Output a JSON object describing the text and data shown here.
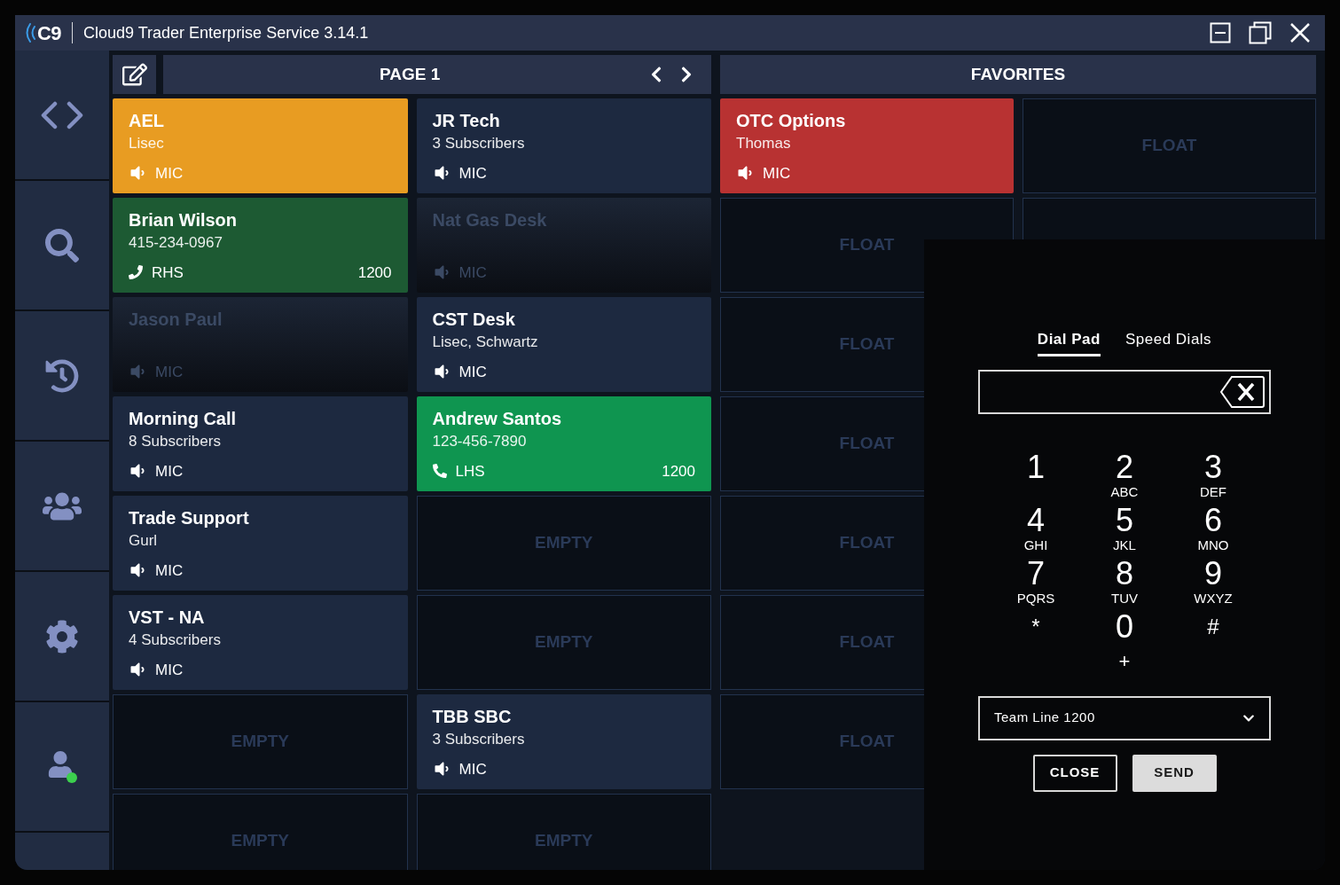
{
  "window": {
    "logo": "C9",
    "title": "Cloud9 Trader Enterprise Service 3.14.1"
  },
  "sidebar": {
    "items": [
      {
        "kind": "code"
      },
      {
        "kind": "search"
      },
      {
        "kind": "history"
      },
      {
        "kind": "users"
      },
      {
        "kind": "settings"
      },
      {
        "kind": "presence",
        "color": "#3ccf4e"
      }
    ]
  },
  "page": {
    "title": "PAGE 1",
    "tiles": [
      {
        "kind": "colored",
        "color": "#e89c22",
        "title": "AEL",
        "subtitle": "Lisec",
        "line": {
          "kind": "speaker",
          "label": "MIC"
        }
      },
      {
        "kind": "normal",
        "title": "JR Tech",
        "subtitle": "3 Subscribers",
        "line": {
          "kind": "speaker",
          "label": "MIC"
        }
      },
      {
        "kind": "colored",
        "color": "#1d5a33",
        "title": "Brian Wilson",
        "subtitle": "415-234-0967",
        "line": {
          "kind": "handset",
          "label": "RHS"
        },
        "extension": "1200"
      },
      {
        "kind": "inactive",
        "title": "Nat Gas Desk",
        "line": {
          "kind": "speaker",
          "label": "MIC"
        }
      },
      {
        "kind": "inactive",
        "title": "Jason Paul",
        "line": {
          "kind": "speaker",
          "label": "MIC"
        }
      },
      {
        "kind": "normal",
        "title": "CST Desk",
        "subtitle": "Lisec, Schwartz",
        "line": {
          "kind": "speaker",
          "label": "MIC"
        }
      },
      {
        "kind": "normal",
        "title": "Morning Call",
        "subtitle": "8 Subscribers",
        "line": {
          "kind": "speaker",
          "label": "MIC"
        }
      },
      {
        "kind": "colored",
        "color": "#0f9550",
        "title": "Andrew Santos",
        "subtitle": "123-456-7890",
        "line": {
          "kind": "phone",
          "label": "LHS"
        },
        "extension": "1200"
      },
      {
        "kind": "normal",
        "title": "Trade Support",
        "subtitle": "Gurl",
        "line": {
          "kind": "speaker",
          "label": "MIC"
        }
      },
      {
        "kind": "empty",
        "label": "EMPTY"
      },
      {
        "kind": "normal",
        "title": "VST - NA",
        "subtitle": "4 Subscribers",
        "line": {
          "kind": "speaker",
          "label": "MIC"
        }
      },
      {
        "kind": "empty",
        "label": "EMPTY"
      },
      {
        "kind": "empty",
        "label": "EMPTY"
      },
      {
        "kind": "normal",
        "title": "TBB SBC",
        "subtitle": "3 Subscribers",
        "line": {
          "kind": "speaker",
          "label": "MIC"
        }
      },
      {
        "kind": "empty",
        "label": "EMPTY"
      },
      {
        "kind": "empty",
        "label": "EMPTY"
      }
    ]
  },
  "favorites": {
    "title": "FAVORITES",
    "tiles": [
      {
        "kind": "colored",
        "color": "#b83232",
        "title": "OTC Options",
        "subtitle": "Thomas",
        "line": {
          "kind": "speaker",
          "label": "MIC"
        }
      },
      {
        "kind": "empty",
        "label": "FLOAT"
      },
      {
        "kind": "empty",
        "label": "FLOAT"
      },
      {
        "kind": "empty"
      },
      {
        "kind": "empty",
        "label": "FLOAT"
      },
      {
        "kind": "blank"
      },
      {
        "kind": "empty",
        "label": "FLOAT"
      },
      {
        "kind": "blank"
      },
      {
        "kind": "empty",
        "label": "FLOAT"
      },
      {
        "kind": "blank"
      },
      {
        "kind": "empty",
        "label": "FLOAT"
      },
      {
        "kind": "blank"
      },
      {
        "kind": "empty",
        "label": "FLOAT"
      }
    ]
  },
  "dial_pad": {
    "tabs": [
      {
        "label": "Dial Pad",
        "selected": true
      },
      {
        "label": "Speed Dials",
        "selected": false
      }
    ],
    "keys": [
      {
        "digit": "1"
      },
      {
        "digit": "2",
        "letters": "ABC"
      },
      {
        "digit": "3",
        "letters": "DEF"
      },
      {
        "digit": "4",
        "letters": "GHI"
      },
      {
        "digit": "5",
        "letters": "JKL"
      },
      {
        "digit": "6",
        "letters": "MNO"
      },
      {
        "digit": "7",
        "letters": "PQRS"
      },
      {
        "digit": "8",
        "letters": "TUV"
      },
      {
        "digit": "9",
        "letters": "WXYZ"
      },
      {
        "digit": "*"
      },
      {
        "digit": "0",
        "letters": "+"
      },
      {
        "digit": "#"
      }
    ],
    "line_select": {
      "value": "Team Line 1200"
    },
    "buttons": [
      {
        "label": "CLOSE",
        "kind": "outline"
      },
      {
        "label": "SEND",
        "kind": "filled"
      }
    ]
  }
}
